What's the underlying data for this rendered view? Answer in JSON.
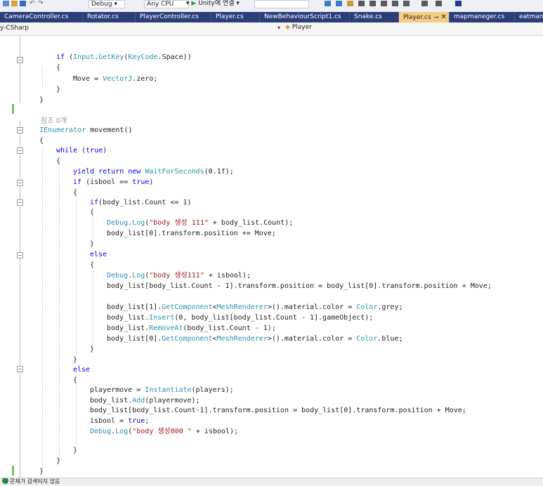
{
  "toolbar": {
    "config": "Debug",
    "platform": "Any CPU",
    "run_target": "Unity에 연결"
  },
  "tabs": [
    {
      "label": "CameraController.cs"
    },
    {
      "label": "Rotator.cs"
    },
    {
      "label": "PlayerController.cs"
    },
    {
      "label": "Player.cs"
    },
    {
      "label": "NewBehaviourScript1.cs"
    },
    {
      "label": "Snake.cs"
    },
    {
      "label": "Player.cs",
      "active": true
    },
    {
      "label": "mapmaneger.cs"
    },
    {
      "label": "eatmaneger.cs"
    }
  ],
  "nav": {
    "project": "y-CSharp",
    "class_name": "Player"
  },
  "editor": {
    "reference_count": "참조 0개"
  },
  "status": {
    "message": "문제가 검색되지 않음"
  },
  "colors": {
    "keyword": "#0000ff",
    "type": "#2b91af",
    "string": "#a31515",
    "tab_bar": "#2c3e7a",
    "active_tab": "#f5cc84",
    "change_marker": "#6ec65a"
  }
}
